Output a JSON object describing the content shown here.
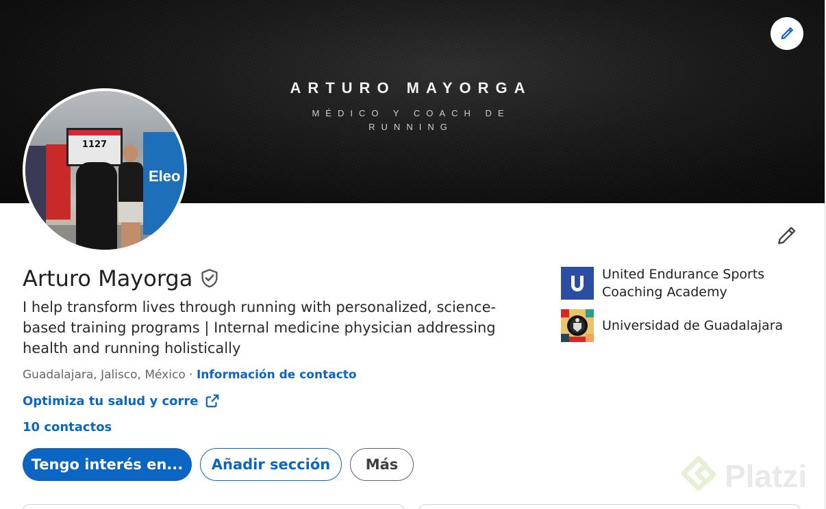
{
  "banner": {
    "title": "ARTURO MAYORGA",
    "subtitle": "MÉDICO Y COACH DE RUNNING",
    "edit_icon": "pencil-icon"
  },
  "avatar": {
    "race_number": "1127",
    "sign_text": "Eleo"
  },
  "profile": {
    "name": "Arturo Mayorga",
    "verified_icon": "shield-check-icon",
    "headline": "I help transform lives through running with personalized, science-based training programs | Internal medicine physician addressing health and running holistically",
    "location": "Guadalajara, Jalisco, México",
    "separator": " · ",
    "contact_info_label": "Información de contacto",
    "website_label": "Optimiza tu salud y corre",
    "website_icon": "external-link-icon",
    "connections": "10 contactos",
    "edit_icon": "pencil-icon"
  },
  "actions": {
    "open_to_label": "Tengo interés en...",
    "add_section_label": "Añadir sección",
    "more_label": "Más"
  },
  "organizations": [
    {
      "name": "United Endurance Sports Coaching Academy",
      "logo_letter": "U"
    },
    {
      "name": "Universidad de Guadalajara"
    }
  ],
  "watermark": {
    "text": "Platzi"
  },
  "colors": {
    "primary": "#0a66c2",
    "banner_bg": "#0d0d0d",
    "text": "#1f1f1f",
    "muted": "#666666"
  }
}
